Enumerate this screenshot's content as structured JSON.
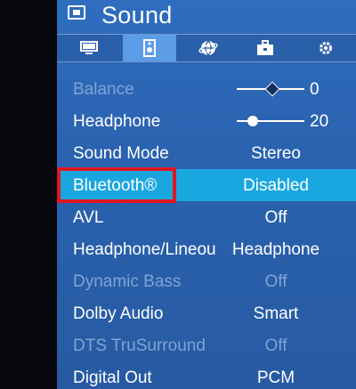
{
  "header": {
    "title": "Sound",
    "icon": "tv-icon"
  },
  "tabs": [
    {
      "name": "picture-tab",
      "icon": "monitor-icon"
    },
    {
      "name": "sound-tab",
      "icon": "speaker-icon",
      "active": true
    },
    {
      "name": "network-tab",
      "icon": "globe-icon"
    },
    {
      "name": "apps-tab",
      "icon": "briefcase-icon"
    },
    {
      "name": "settings-tab",
      "icon": "gear-icon"
    }
  ],
  "menu": {
    "balance": {
      "label": "Balance",
      "value": "0",
      "level": 0.5
    },
    "headphone": {
      "label": "Headphone",
      "value": "20",
      "level": 0.2
    },
    "sound_mode": {
      "label": "Sound Mode",
      "value": "Stereo"
    },
    "bluetooth": {
      "label": "Bluetooth®",
      "value": "Disabled"
    },
    "avl": {
      "label": "AVL",
      "value": "Off"
    },
    "headphone_lineout": {
      "label": "Headphone/Lineou",
      "value": "Headphone"
    },
    "dynamic_bass": {
      "label": "Dynamic Bass",
      "value": "Off"
    },
    "dolby_audio": {
      "label": "Dolby Audio",
      "value": "Smart"
    },
    "dts": {
      "label": "DTS TruSurround",
      "value": "Off"
    },
    "digital_out": {
      "label": "Digital Out",
      "value": "PCM"
    }
  },
  "colors": {
    "panel": "#2a62ae",
    "selected_row": "#1aa7e0",
    "annotation_box": "#e0171f"
  }
}
